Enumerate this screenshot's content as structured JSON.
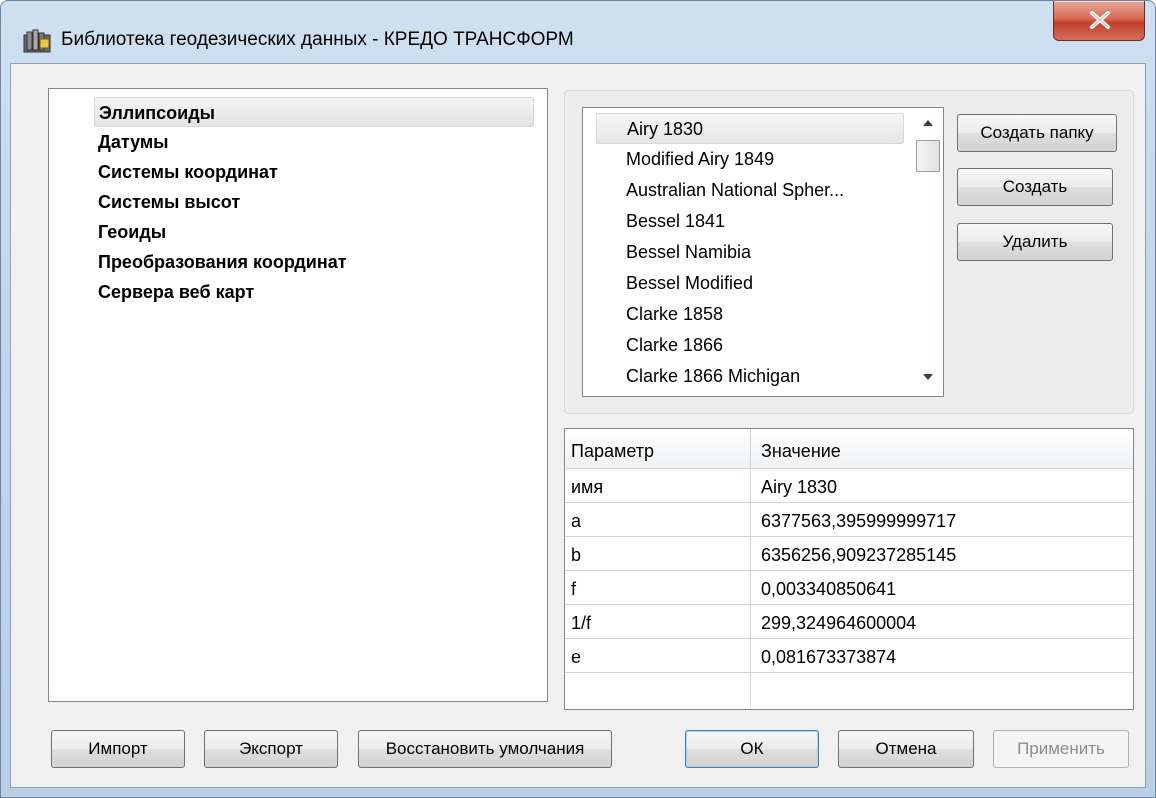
{
  "window": {
    "title": "Библиотека геодезических данных - КРЕДО ТРАНСФОРМ",
    "close_glyph": "X"
  },
  "tree": {
    "items": [
      {
        "label": "Эллипсоиды",
        "selected": true
      },
      {
        "label": "Датумы"
      },
      {
        "label": "Системы координат"
      },
      {
        "label": "Системы высот"
      },
      {
        "label": "Геоиды"
      },
      {
        "label": "Преобразования координат"
      },
      {
        "label": "Сервера веб карт"
      }
    ]
  },
  "list": {
    "items": [
      {
        "label": "Airy 1830",
        "selected": true
      },
      {
        "label": "Modified Airy 1849"
      },
      {
        "label": "Australian National Spher..."
      },
      {
        "label": "Bessel 1841"
      },
      {
        "label": "Bessel Namibia"
      },
      {
        "label": "Bessel Modified"
      },
      {
        "label": "Clarke 1858"
      },
      {
        "label": "Clarke 1866"
      },
      {
        "label": "Clarke 1866 Michigan"
      }
    ],
    "scroll_up_icon": "triangle-up",
    "scroll_down_icon": "triangle-down"
  },
  "side_buttons": {
    "create_folder": "Создать папку",
    "create": "Создать",
    "delete": "Удалить"
  },
  "params": {
    "headers": [
      "Параметр",
      "Значение"
    ],
    "rows": [
      [
        "имя",
        "Airy 1830"
      ],
      [
        "a",
        "6377563,395999999717"
      ],
      [
        "b",
        "6356256,909237285145"
      ],
      [
        "f",
        "0,003340850641"
      ],
      [
        "1/f",
        "299,324964600004"
      ],
      [
        "e",
        "0,081673373874"
      ]
    ]
  },
  "footer": {
    "import": "Импорт",
    "export": "Экспорт",
    "restore_defaults": "Восстановить умолчания",
    "ok": "ОК",
    "cancel": "Отмена",
    "apply": "Применить"
  }
}
